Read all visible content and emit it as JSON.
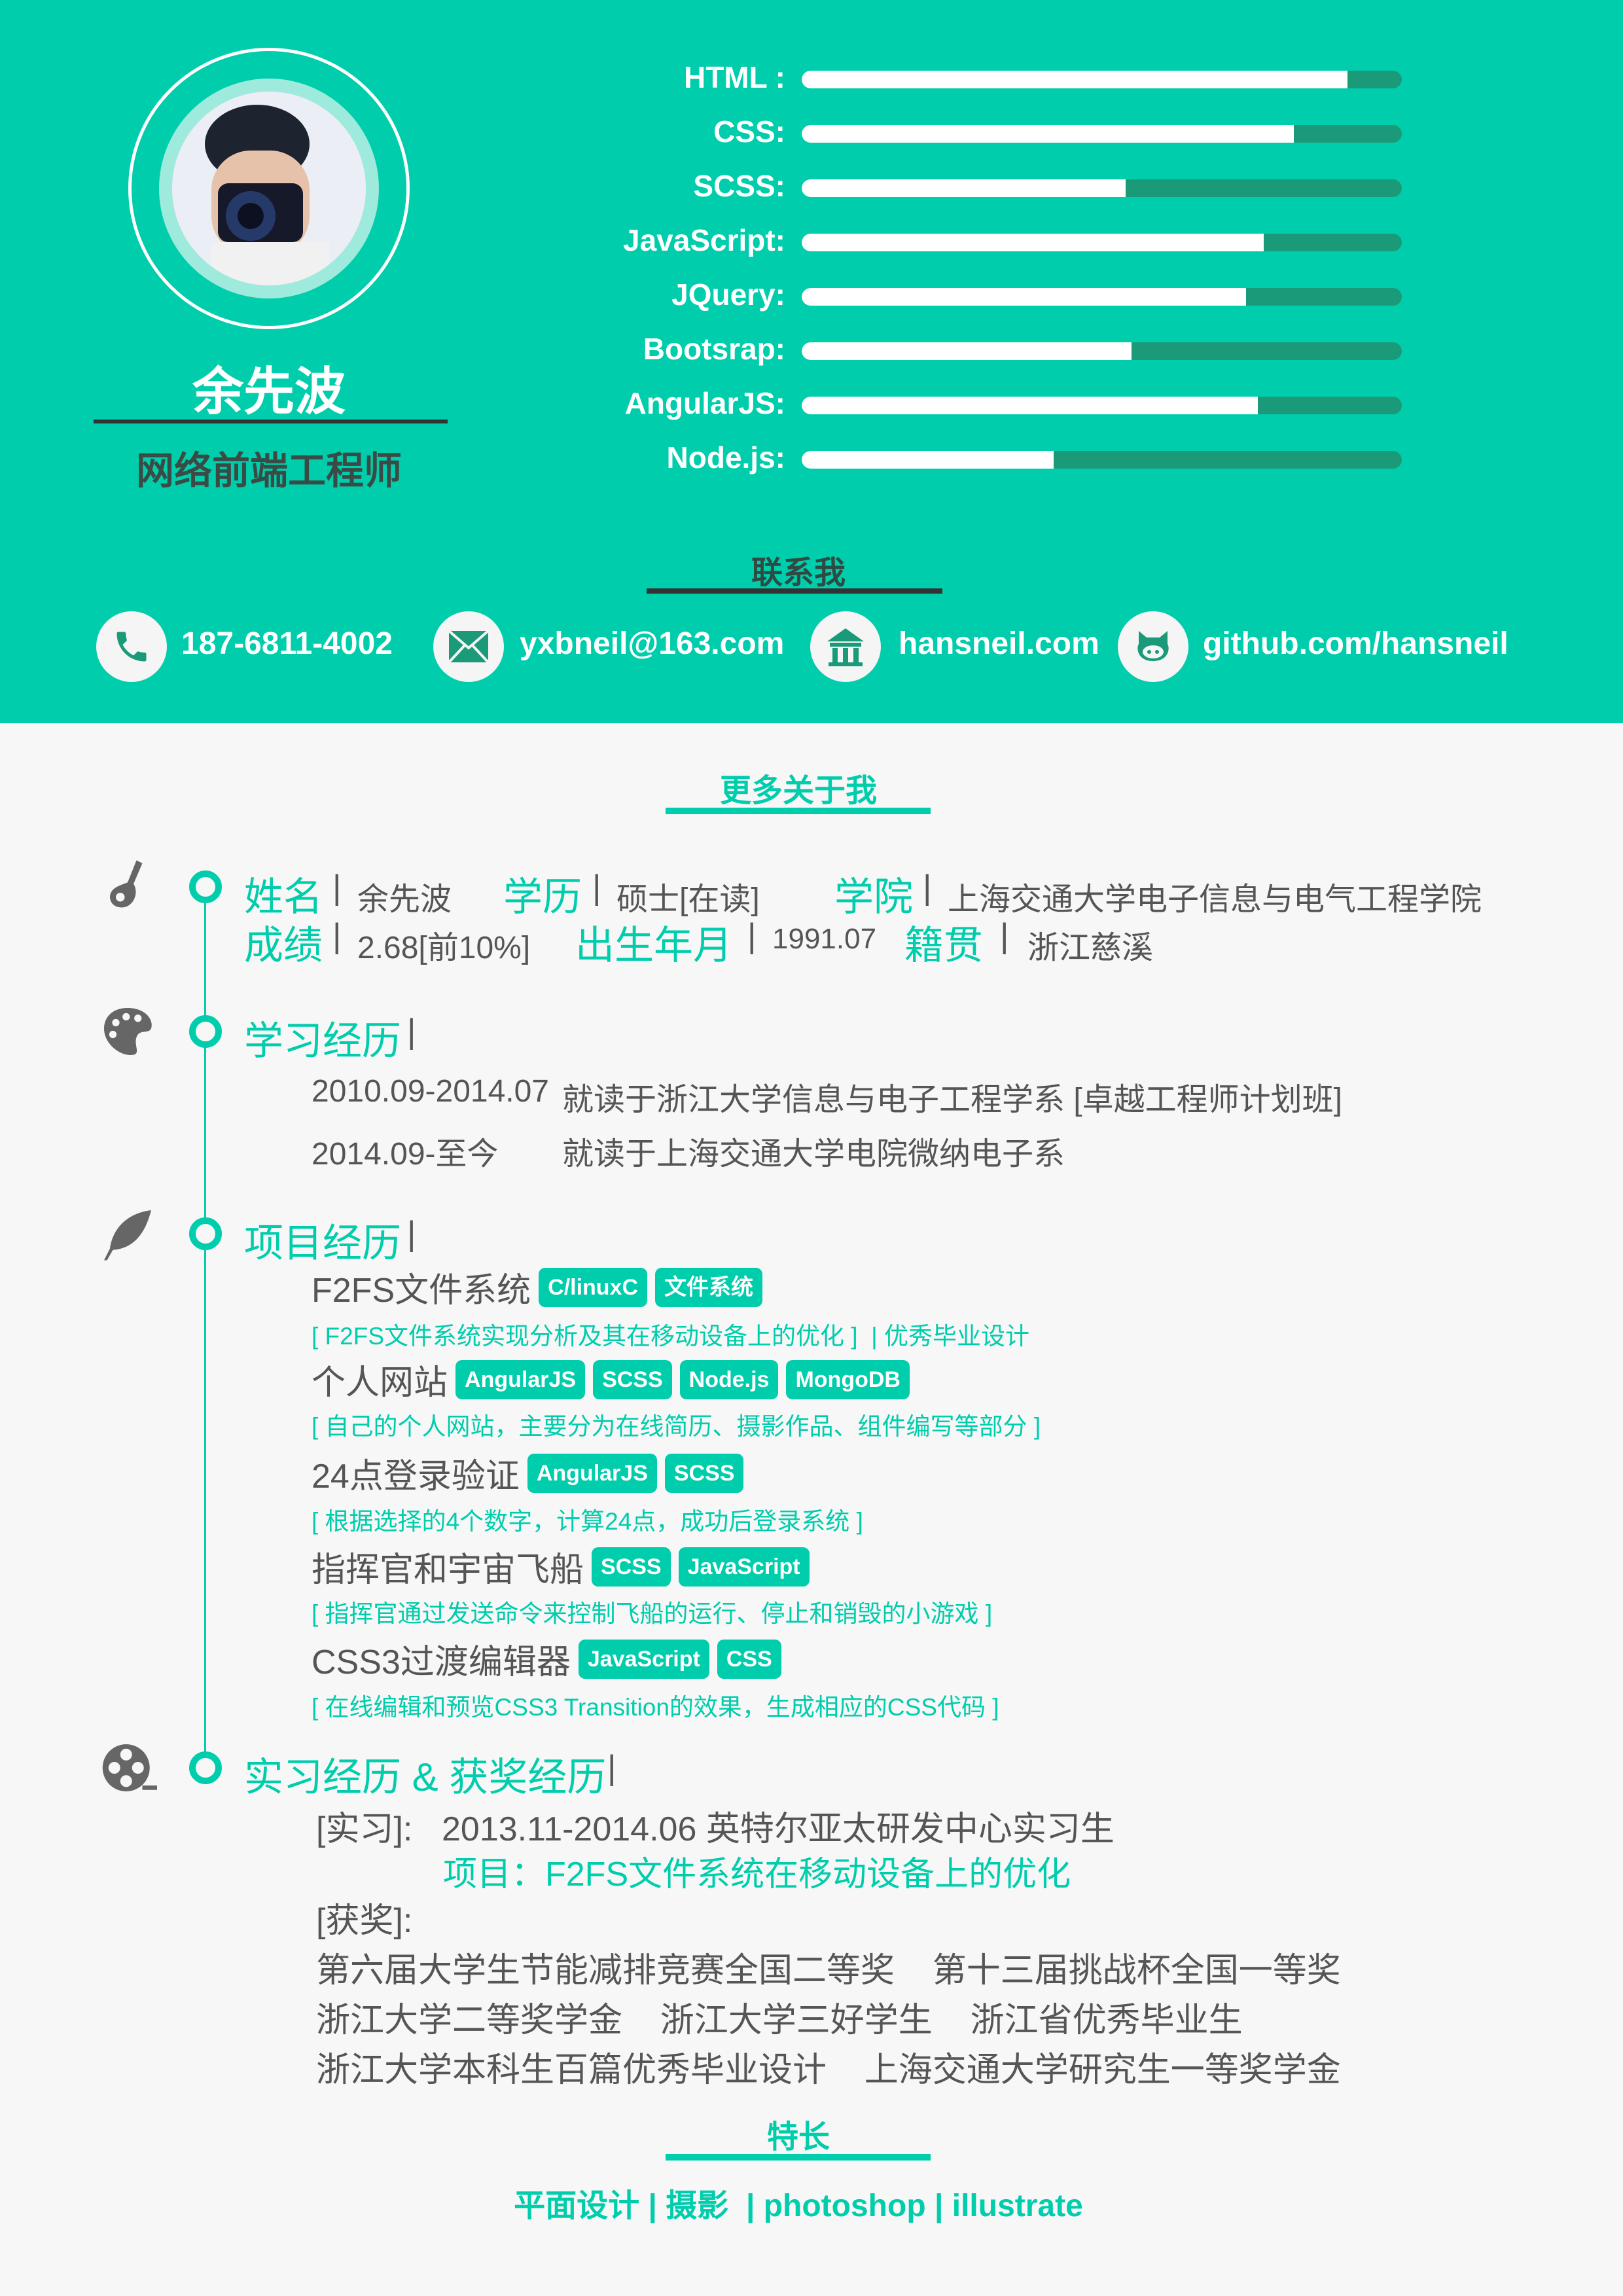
{
  "profile": {
    "name": "余先波",
    "title": "网络前端工程师"
  },
  "skills": [
    {
      "label": "HTML :",
      "level": 0.91
    },
    {
      "label": "CSS:",
      "level": 0.82
    },
    {
      "label": "SCSS:",
      "level": 0.54
    },
    {
      "label": "JavaScript:",
      "level": 0.77
    },
    {
      "label": "JQuery:",
      "level": 0.74
    },
    {
      "label": "Bootsrap:",
      "level": 0.55
    },
    {
      "label": "AngularJS:",
      "level": 0.76
    },
    {
      "label": "Node.js:",
      "level": 0.42
    }
  ],
  "contact": {
    "title": "联系我",
    "phone": "187-6811-4002",
    "email": "yxbneil@163.com",
    "website": "hansneil.com",
    "github": "github.com/hansneil"
  },
  "about": {
    "title": "更多关于我",
    "info": {
      "name_label": "姓名",
      "name_value": "余先波",
      "degree_label": "学历",
      "degree_value": "硕士[在读]",
      "school_label": "学院",
      "school_value": "上海交通大学电子信息与电气工程学院",
      "gpa_label": "成绩",
      "gpa_value": "2.68[前10%]",
      "birth_label": "出生年月",
      "birth_value": "1991.07",
      "hometown_label": "籍贯",
      "hometown_value": "浙江慈溪",
      "separator": "|"
    },
    "education": {
      "title": "学习经历",
      "items": [
        {
          "date": "2010.09-2014.07",
          "desc": "就读于浙江大学信息与电子工程学系 [卓越工程师计划班]"
        },
        {
          "date": "2014.09-至今",
          "desc": "就读于上海交通大学电院微纳电子系"
        }
      ]
    },
    "projects": {
      "title": "项目经历",
      "items": [
        {
          "name": "F2FS文件系统",
          "tags": [
            "C/linuxC",
            "文件系统"
          ],
          "desc": "[ F2FS文件系统实现分析及其在移动设备上的优化 ]  | 优秀毕业设计"
        },
        {
          "name": "个人网站",
          "tags": [
            "AngularJS",
            "SCSS",
            "Node.js",
            "MongoDB"
          ],
          "desc": "[ 自己的个人网站，主要分为在线简历、摄影作品、组件编写等部分 ]"
        },
        {
          "name": "24点登录验证",
          "tags": [
            "AngularJS",
            "SCSS"
          ],
          "desc": "[ 根据选择的4个数字，计算24点，成功后登录系统 ]"
        },
        {
          "name": "指挥官和宇宙飞船",
          "tags": [
            "SCSS",
            "JavaScript"
          ],
          "desc": "[ 指挥官通过发送命令来控制飞船的运行、停止和销毁的小游戏 ]"
        },
        {
          "name": "CSS3过渡编辑器",
          "tags": [
            "JavaScript",
            "CSS"
          ],
          "desc": "[ 在线编辑和预览CSS3 Transition的效果，生成相应的CSS代码 ]"
        }
      ]
    },
    "experience": {
      "title": "实习经历 & 获奖经历",
      "intern_label": "[实习]:",
      "intern_value": "2013.11-2014.06 英特尔亚太研发中心实习生",
      "intern_project": "项目：F2FS文件系统在移动设备上的优化",
      "awards_label": "[获奖]:",
      "awards": [
        "第六届大学生节能减排竞赛全国二等奖    第十三届挑战杯全国一等奖",
        "浙江大学二等奖学金    浙江大学三好学生    浙江省优秀毕业生",
        "浙江大学本科生百篇优秀毕业设计    上海交通大学研究生一等奖学金"
      ]
    }
  },
  "specialties": {
    "title": "特长",
    "text": "平面设计 | 摄影  | photoshop | illustrate"
  },
  "colors": {
    "accent": "#00cdac",
    "bar_track": "#1a9a78",
    "text": "#555555"
  }
}
